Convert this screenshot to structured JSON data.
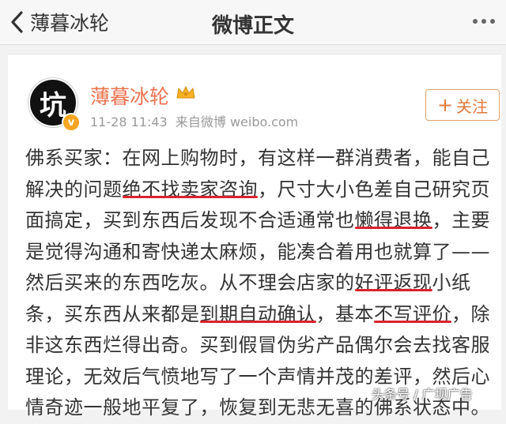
{
  "nav": {
    "back_label": "薄暮冰轮",
    "title": "微博正文"
  },
  "post": {
    "avatar_text": "坑",
    "username": "薄暮冰轮",
    "timestamp": "11-28 11:43",
    "source": "来自微博 weibo.com",
    "follow_label": "关注",
    "lines": [
      [
        {
          "t": "佛系买家：在网上购物时，有这样一群消费者，能自己"
        }
      ],
      [
        {
          "t": "解决的问题"
        },
        {
          "t": "绝不找卖家咨询",
          "u": true
        },
        {
          "t": "，尺寸大小色差自己研究页"
        }
      ],
      [
        {
          "t": "面搞定，买到东西后发现不合适通常也"
        },
        {
          "t": "懒得退换",
          "u": true
        },
        {
          "t": "，主要"
        }
      ],
      [
        {
          "t": "是觉得沟通和寄快递太麻烦，能凑合着用也就算了——"
        }
      ],
      [
        {
          "t": "然后买来的东西吃灰。从不理会店家的"
        },
        {
          "t": "好评返现",
          "u": true
        },
        {
          "t": "小纸"
        }
      ],
      [
        {
          "t": "条，买东西从来都是"
        },
        {
          "t": "到期自动确认",
          "u": true
        },
        {
          "t": "，基本"
        },
        {
          "t": "不写评价",
          "u": true
        },
        {
          "t": "，除"
        }
      ],
      [
        {
          "t": "非这东西烂得出奇。买到假冒伪劣产品偶尔会去找客服"
        }
      ],
      [
        {
          "t": "理论，无效后气愤地写了一个声情并茂的差评，然后心"
        }
      ],
      [
        {
          "t": "情奇迹一般地平复了，恢复到无悲无喜的佛系状态中。"
        }
      ]
    ]
  },
  "watermark": "头条号 / 广坝广告",
  "colors": {
    "username": "#eb7350",
    "underline": "#d9232d",
    "follow": "#e07a3a"
  }
}
